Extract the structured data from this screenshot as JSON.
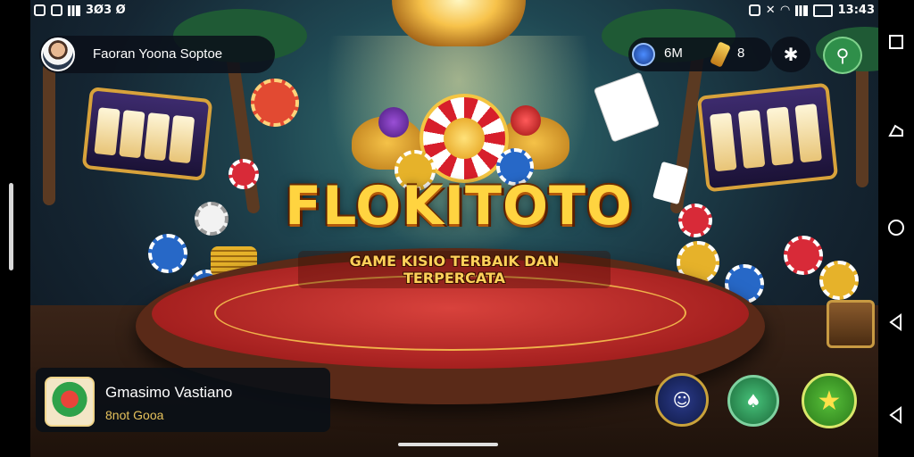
{
  "status_bar": {
    "left_text": "3Ø3 Ø",
    "right_time": "13:43"
  },
  "profile": {
    "name": "Faoran Yoona  Soptoe"
  },
  "currency": {
    "coins": "6M",
    "gems": "8"
  },
  "logo": {
    "title": "FLOKITOTO",
    "tagline": "GAME KISIO TERBAIK DAN TERPERCATA"
  },
  "game_card": {
    "title": "Gmasimo Vastiano",
    "subtitle": "8not Gooa"
  },
  "colors": {
    "logo_gold": "#ffd440",
    "table_felt": "#c92a28",
    "accent_green": "#3cae3a"
  },
  "icons": {
    "top_buttons": [
      "chip-stack-icon",
      "person-pin-icon"
    ],
    "bottom_buttons": [
      "character-avatar-icon",
      "emblem-icon",
      "star-icon"
    ],
    "nav": [
      "square-nav-icon",
      "back-nav-icon",
      "home-nav-icon",
      "triangle-nav-icon",
      "triangle-nav-icon"
    ]
  }
}
